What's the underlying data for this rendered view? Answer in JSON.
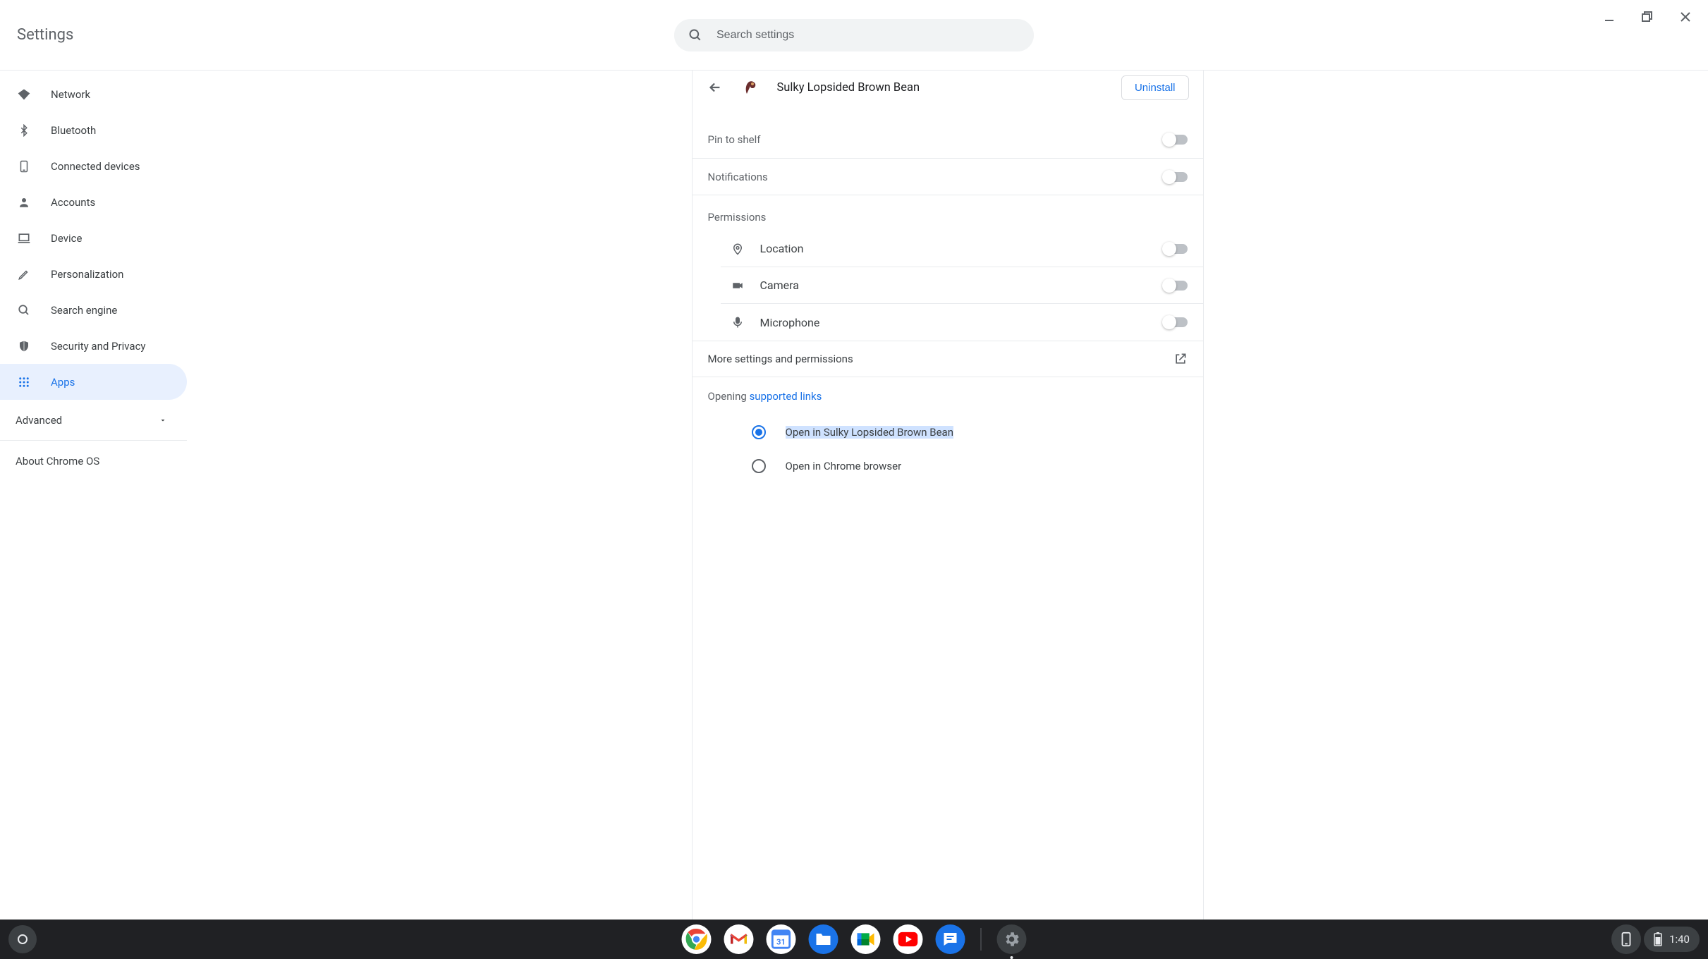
{
  "app_title": "Settings",
  "search": {
    "placeholder": "Search settings"
  },
  "sidebar": {
    "items": [
      {
        "label": "Network"
      },
      {
        "label": "Bluetooth"
      },
      {
        "label": "Connected devices"
      },
      {
        "label": "Accounts"
      },
      {
        "label": "Device"
      },
      {
        "label": "Personalization"
      },
      {
        "label": "Search engine"
      },
      {
        "label": "Security and Privacy"
      },
      {
        "label": "Apps"
      }
    ],
    "advanced_label": "Advanced",
    "about_label": "About Chrome OS"
  },
  "detail": {
    "title": "Sulky Lopsided Brown Bean",
    "uninstall_label": "Uninstall",
    "pin_label": "Pin to shelf",
    "notifications_label": "Notifications",
    "permissions_heading": "Permissions",
    "permissions": {
      "location": "Location",
      "camera": "Camera",
      "microphone": "Microphone"
    },
    "more_settings_label": "More settings and permissions",
    "opening_prefix": "Opening ",
    "supported_links_label": "supported links",
    "radio_open_in_app": "Open in Sulky Lopsided Brown Bean",
    "radio_open_in_chrome": "Open in Chrome browser"
  },
  "shelf": {
    "time": "1:40"
  }
}
